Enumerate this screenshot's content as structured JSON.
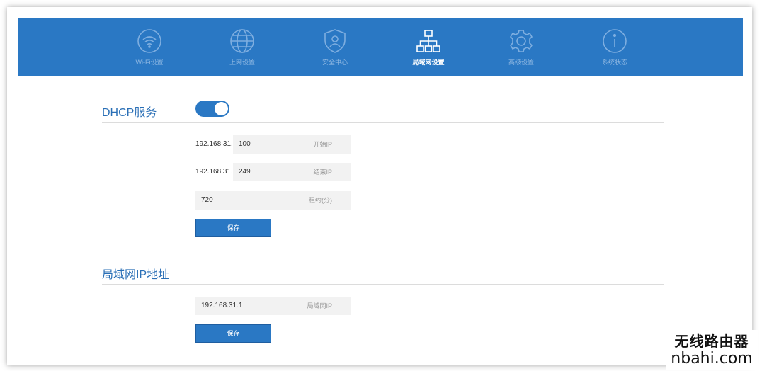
{
  "nav": {
    "items": [
      {
        "label": "Wi-Fi设置",
        "icon": "wifi-icon"
      },
      {
        "label": "上网设置",
        "icon": "globe-icon"
      },
      {
        "label": "安全中心",
        "icon": "shield-user-icon"
      },
      {
        "label": "局域网设置",
        "icon": "network-icon",
        "active": true
      },
      {
        "label": "高级设置",
        "icon": "gear-icon"
      },
      {
        "label": "系统状态",
        "icon": "info-icon"
      }
    ]
  },
  "dhcp": {
    "title": "DHCP服务",
    "enabled": true,
    "start_prefix": "192.168.31.",
    "start_value": "100",
    "start_placeholder": "开始IP",
    "end_prefix": "192.168.31.",
    "end_value": "249",
    "end_placeholder": "结束IP",
    "lease_value": "720",
    "lease_placeholder": "租约(分)",
    "save_label": "保存"
  },
  "lan": {
    "title": "局域网IP地址",
    "ip_value": "192.168.31.1",
    "ip_placeholder": "局域网IP",
    "save_label": "保存"
  },
  "watermark": {
    "title": "无线路由器",
    "url": "nbahi.com"
  },
  "colors": {
    "accent": "#2a78c4",
    "section_title": "#2a6fb6"
  }
}
